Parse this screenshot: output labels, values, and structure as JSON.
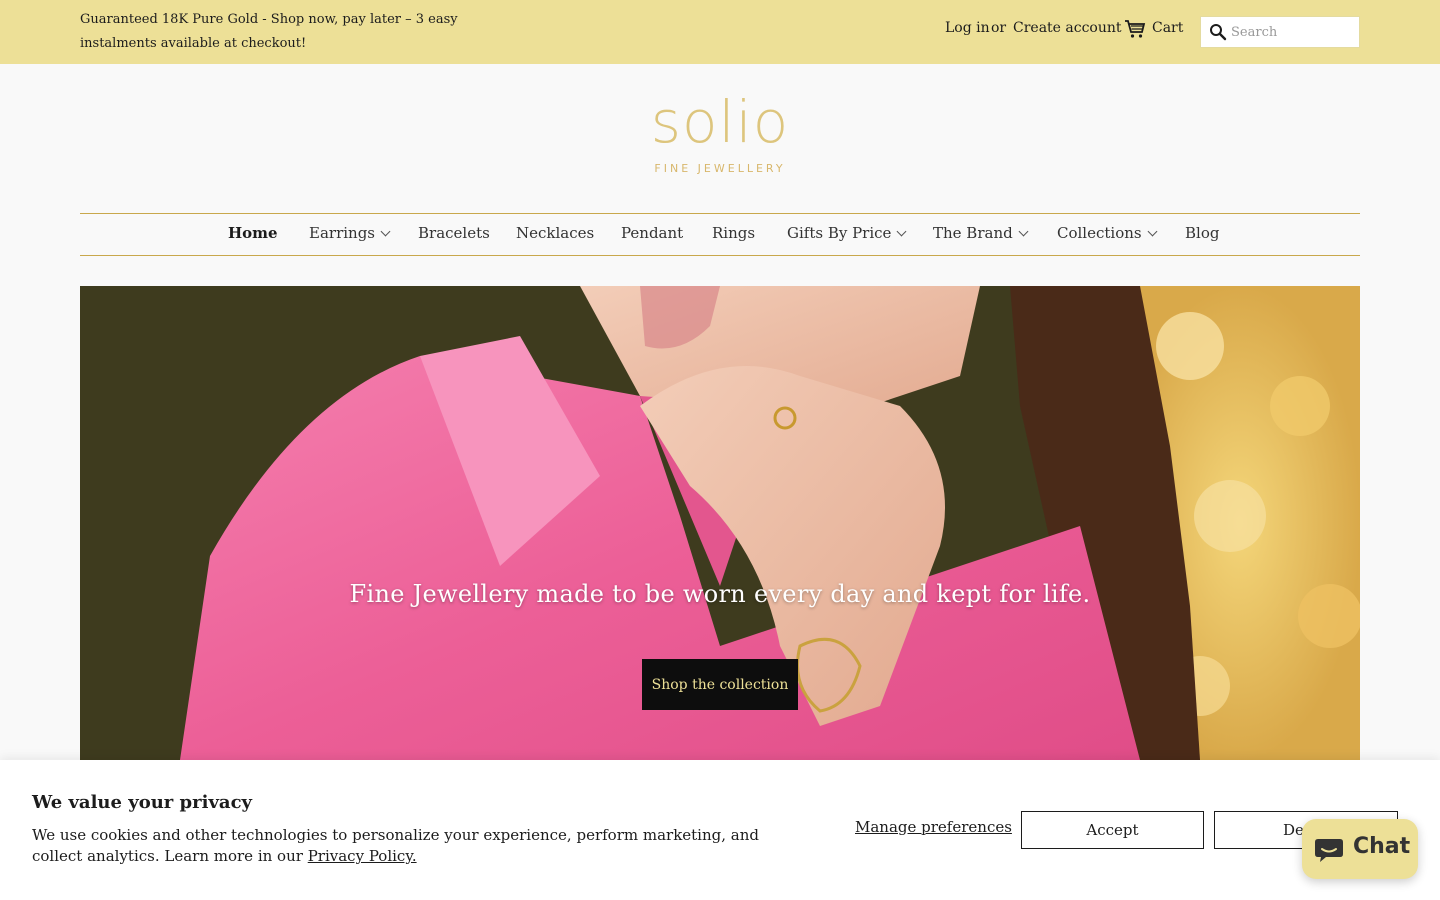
{
  "topbar": {
    "announcement": "Guaranteed 18K Pure Gold - Shop now, pay later – 3 easy instalments available at checkout!",
    "login": "Log in",
    "or": "or",
    "create_account": "Create account",
    "cart": "Cart",
    "search_placeholder": "Search"
  },
  "logo": {
    "wordmark": "solio",
    "tagline": "FINE JEWELLERY"
  },
  "nav": {
    "items": [
      {
        "label": "Home"
      },
      {
        "label": "Earrings"
      },
      {
        "label": "Bracelets"
      },
      {
        "label": "Necklaces"
      },
      {
        "label": "Pendant"
      },
      {
        "label": "Rings"
      },
      {
        "label": "Gifts By Price"
      },
      {
        "label": "The Brand"
      },
      {
        "label": "Collections"
      },
      {
        "label": "Blog"
      }
    ]
  },
  "hero": {
    "headline": "Fine Jewellery made to be worn every day and kept for life.",
    "cta": "Shop the collection"
  },
  "cookie": {
    "title": "We value your privacy",
    "body": "We use cookies and other technologies to personalize your experience, perform marketing, and collect analytics. Learn more in our",
    "link": "Privacy Policy.",
    "manage": "Manage preferences",
    "accept": "Accept",
    "decline": "Decline"
  },
  "chat": {
    "label": "Chat"
  },
  "colors": {
    "accent": "#ede097",
    "gold": "#c9a84c",
    "button_dark": "#0d0d0d"
  },
  "icons": [
    "cart-icon",
    "search-icon",
    "chevron-down-icon",
    "chat-bubble-icon"
  ]
}
